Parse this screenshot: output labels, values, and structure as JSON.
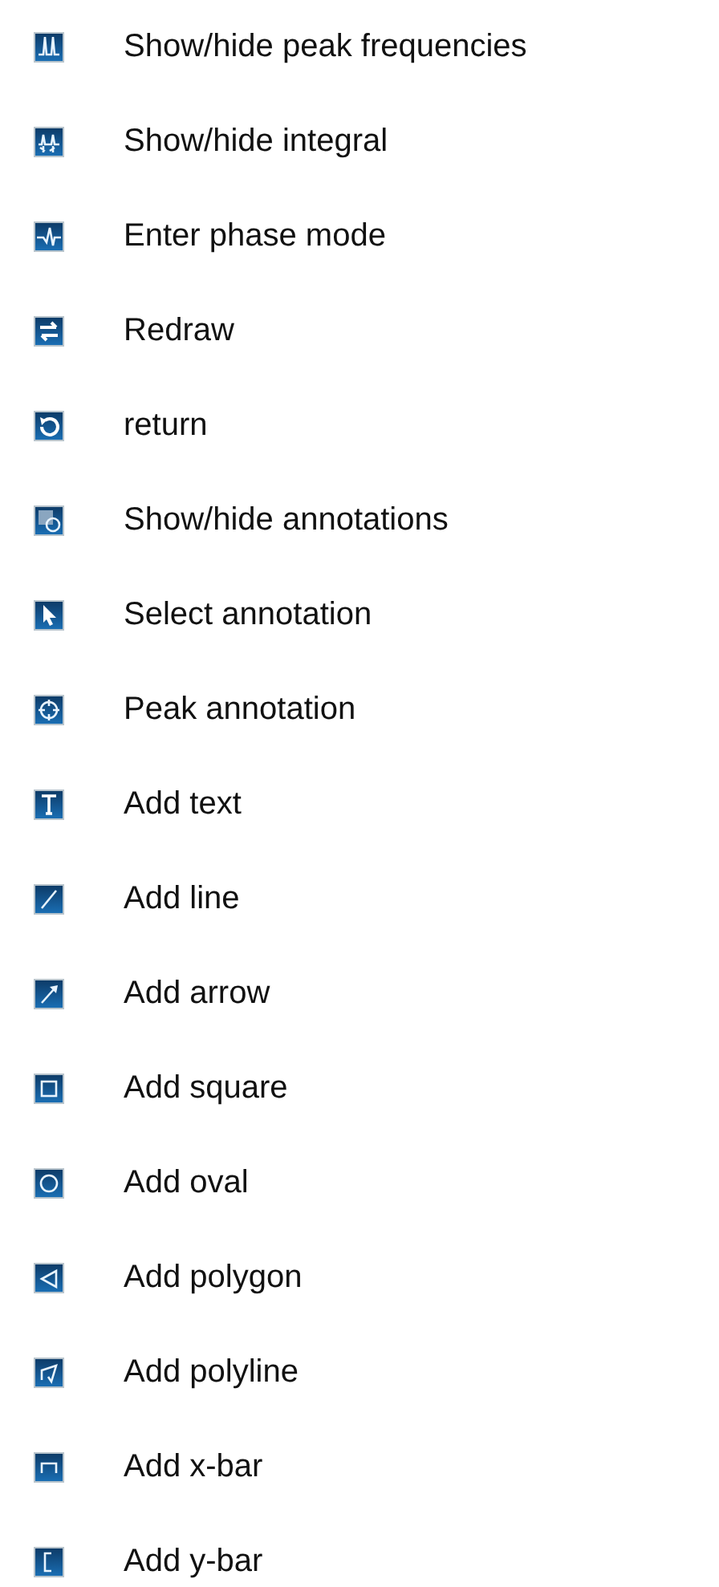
{
  "items": [
    {
      "label": "Show/hide peak frequencies"
    },
    {
      "label": "Show/hide integral"
    },
    {
      "label": "Enter phase mode"
    },
    {
      "label": "Redraw"
    },
    {
      "label": "return"
    },
    {
      "label": "Show/hide annotations"
    },
    {
      "label": "Select annotation"
    },
    {
      "label": "Peak annotation"
    },
    {
      "label": "Add text"
    },
    {
      "label": "Add line"
    },
    {
      "label": "Add arrow"
    },
    {
      "label": "Add square"
    },
    {
      "label": "Add oval"
    },
    {
      "label": "Add polygon"
    },
    {
      "label": "Add polyline"
    },
    {
      "label": "Add x-bar"
    },
    {
      "label": "Add y-bar"
    }
  ]
}
